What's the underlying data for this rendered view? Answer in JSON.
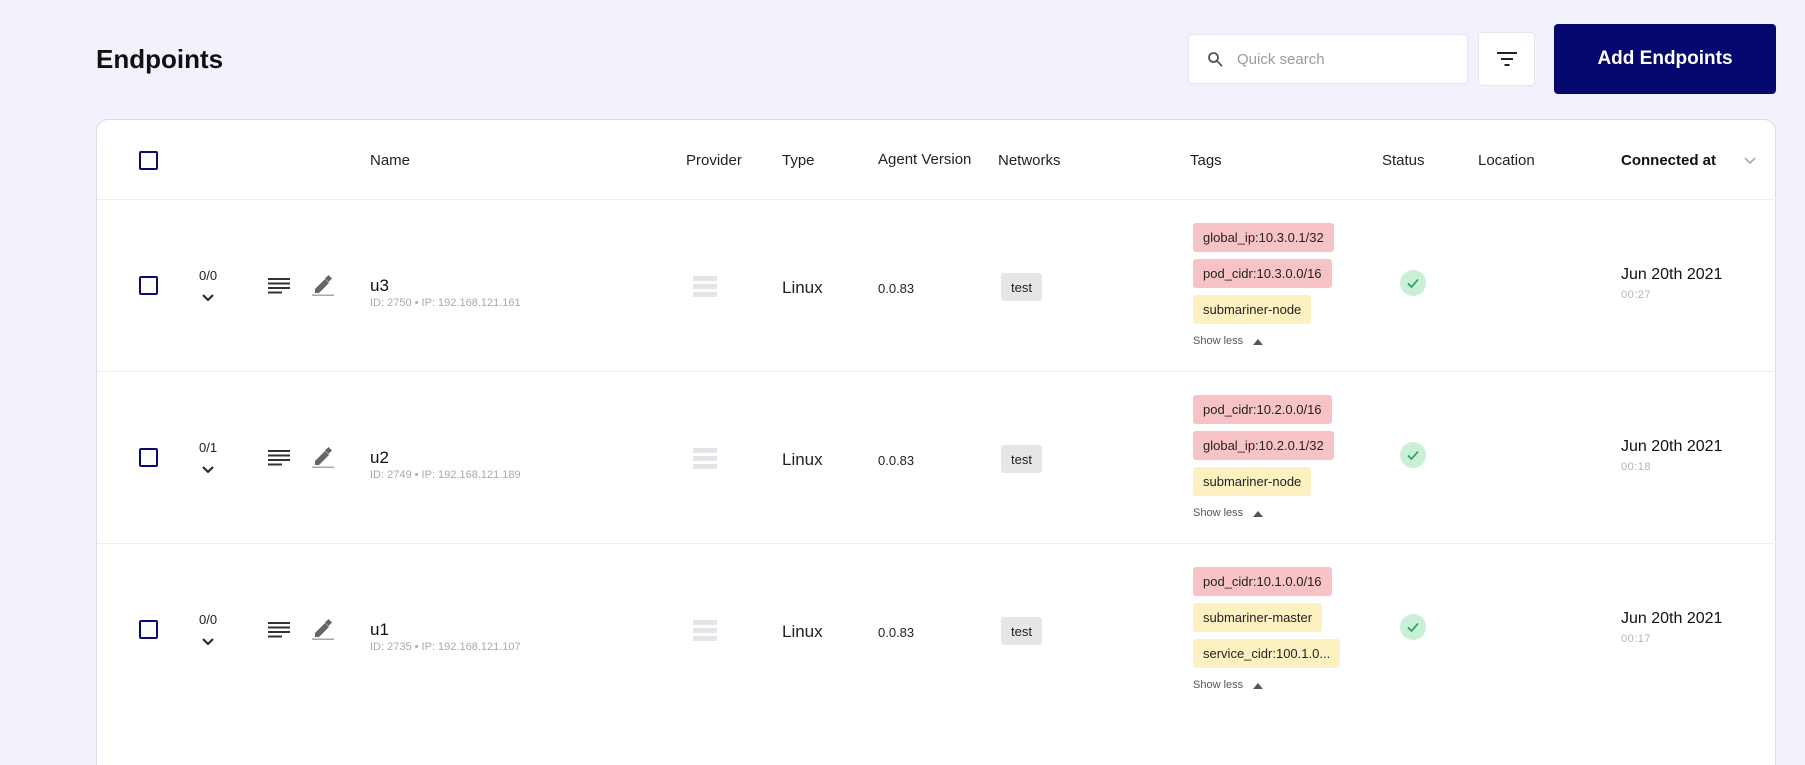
{
  "header": {
    "title": "Endpoints",
    "search_placeholder": "Quick search",
    "add_button": "Add Endpoints"
  },
  "table": {
    "columns": {
      "name": "Name",
      "provider": "Provider",
      "type": "Type",
      "agent_version": "Agent Version",
      "networks": "Networks",
      "tags": "Tags",
      "status": "Status",
      "location": "Location",
      "connected_at": "Connected at"
    },
    "rows": [
      {
        "count": "0/0",
        "name": "u3",
        "meta": "ID: 2750 • IP: 192.168.121.161",
        "type": "Linux",
        "version": "0.0.83",
        "network": "test",
        "tags": [
          {
            "label": "global_ip:10.3.0.1/32",
            "color": "#f8c3c7"
          },
          {
            "label": "pod_cidr:10.3.0.0/16",
            "color": "#f8c3c7"
          },
          {
            "label": "submariner-node",
            "color": "#fdf1c2"
          }
        ],
        "show_less": "Show less",
        "status": "connected",
        "date": "Jun 20th 2021",
        "time": "00:27"
      },
      {
        "count": "0/1",
        "name": "u2",
        "meta": "ID: 2749 • IP: 192.168.121.189",
        "type": "Linux",
        "version": "0.0.83",
        "network": "test",
        "tags": [
          {
            "label": "pod_cidr:10.2.0.0/16",
            "color": "#f8c3c7"
          },
          {
            "label": "global_ip:10.2.0.1/32",
            "color": "#f8c3c7"
          },
          {
            "label": "submariner-node",
            "color": "#fdf1c2"
          }
        ],
        "show_less": "Show less",
        "status": "connected",
        "date": "Jun 20th 2021",
        "time": "00:18"
      },
      {
        "count": "0/0",
        "name": "u1",
        "meta": "ID: 2735 • IP: 192.168.121.107",
        "type": "Linux",
        "version": "0.0.83",
        "network": "test",
        "tags": [
          {
            "label": "pod_cidr:10.1.0.0/16",
            "color": "#f8c3c7"
          },
          {
            "label": "submariner-master",
            "color": "#fdf1c2"
          },
          {
            "label": "service_cidr:100.1.0...",
            "color": "#fdf1c2"
          }
        ],
        "show_less": "Show less",
        "status": "connected",
        "date": "Jun 20th 2021",
        "time": "00:17"
      }
    ]
  },
  "colors": {
    "primary": "#05076e",
    "page_bg": "#f1f2fb",
    "status_ok": "#c9efd6"
  }
}
